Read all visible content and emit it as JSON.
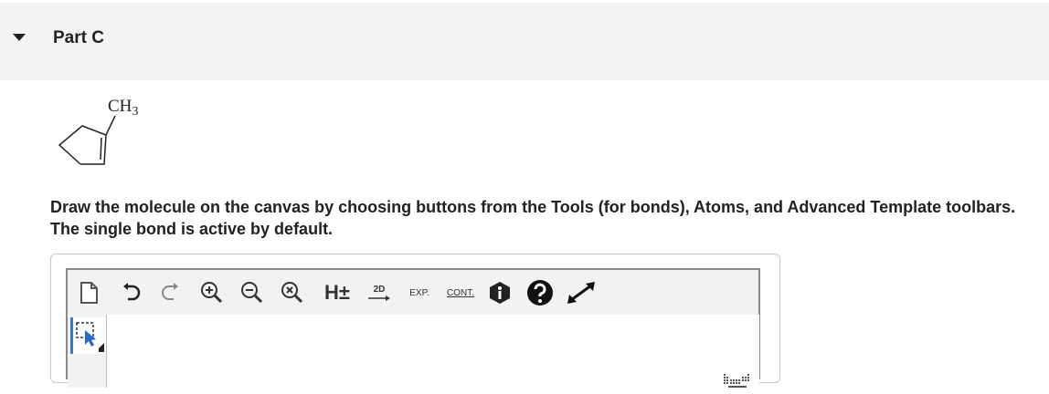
{
  "part": {
    "title": "Part C"
  },
  "molecule": {
    "label": "CH3",
    "label_main": "CH",
    "label_sub": "3"
  },
  "instructions": "Draw the molecule on the canvas by choosing buttons from the Tools (for bonds), Atoms, and Advanced Template toolbars. The single bond is active by default.",
  "toolbar": {
    "h_toggle": "H±",
    "twod_label": "2D",
    "exp_label": "EXP.",
    "cont_label": "CONT."
  },
  "colors": {
    "header_bg": "#f4f4f4",
    "select_accent": "#3a78c8"
  }
}
